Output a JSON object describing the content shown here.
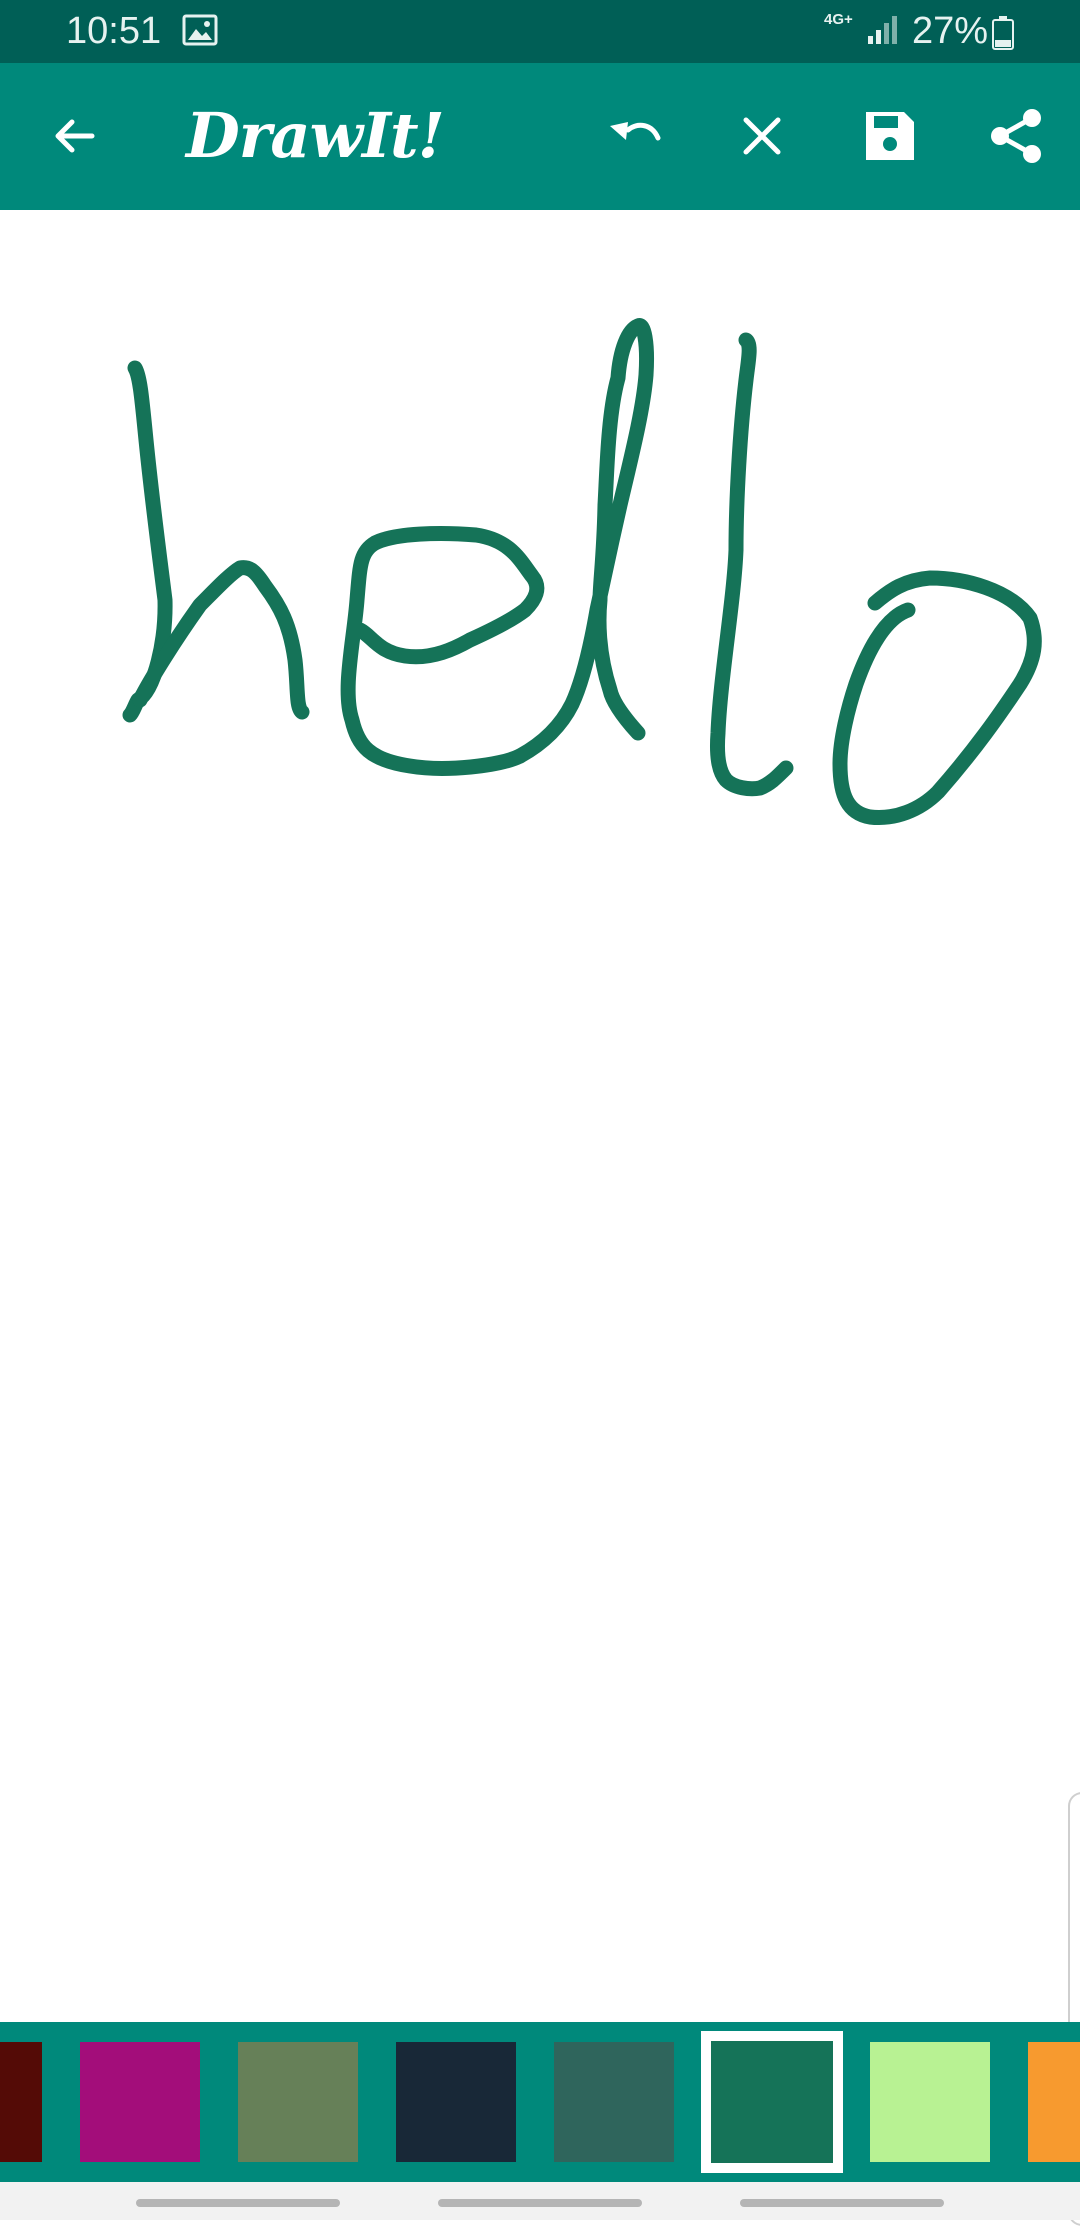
{
  "status_bar": {
    "time": "10:51",
    "network_type": "4G+",
    "battery": "27%",
    "icons": [
      "image-icon",
      "signal-icon",
      "battery-icon"
    ]
  },
  "app_bar": {
    "title": "DrawIt!",
    "background": "#00897b",
    "buttons": [
      "back-arrow-icon",
      "undo-icon",
      "clear-icon",
      "save-icon",
      "share-icon"
    ]
  },
  "canvas": {
    "stroke_color": "#157358",
    "drawn_word": "hello"
  },
  "palette": {
    "swatches": [
      {
        "name": "dark-red",
        "color": "#540b06"
      },
      {
        "name": "magenta",
        "color": "#a30d7a"
      },
      {
        "name": "olive-green",
        "color": "#668058"
      },
      {
        "name": "navy",
        "color": "#182837"
      },
      {
        "name": "slate-teal",
        "color": "#2f655c"
      },
      {
        "name": "teal-green",
        "color": "#157358",
        "selected": true
      },
      {
        "name": "light-green",
        "color": "#b8f293"
      },
      {
        "name": "orange",
        "color": "#f79a2f"
      }
    ]
  }
}
